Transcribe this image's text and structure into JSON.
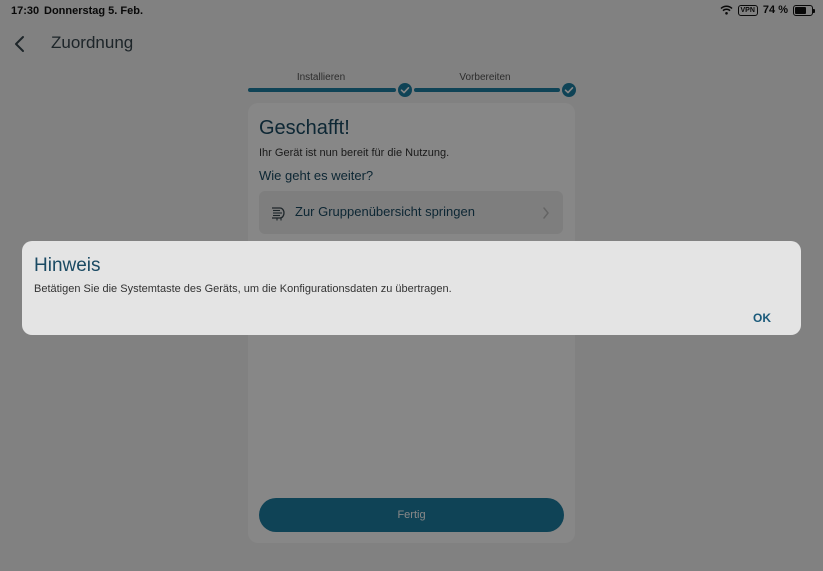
{
  "status_bar": {
    "time": "17:30",
    "date": "Donnerstag 5. Feb.",
    "vpn": "VPN",
    "battery": "74 %"
  },
  "header": {
    "title": "Zuordnung"
  },
  "steps": [
    {
      "label": "Installieren"
    },
    {
      "label": "Vorbereiten"
    }
  ],
  "card": {
    "title": "Geschafft!",
    "text": "Ihr Gerät ist nun bereit für die Nutzung.",
    "next_title": "Wie geht es weiter?",
    "group_link": "Zur Gruppenübersicht springen",
    "finish_button": "Fertig"
  },
  "dialog": {
    "title": "Hinweis",
    "message": "Betätigen Sie die Systemtaste des Geräts, um die Konfigurationsdaten zu übertragen.",
    "ok_button": "OK"
  },
  "colors": {
    "accent": "#1d7fa3",
    "heading": "#1a4a63"
  }
}
